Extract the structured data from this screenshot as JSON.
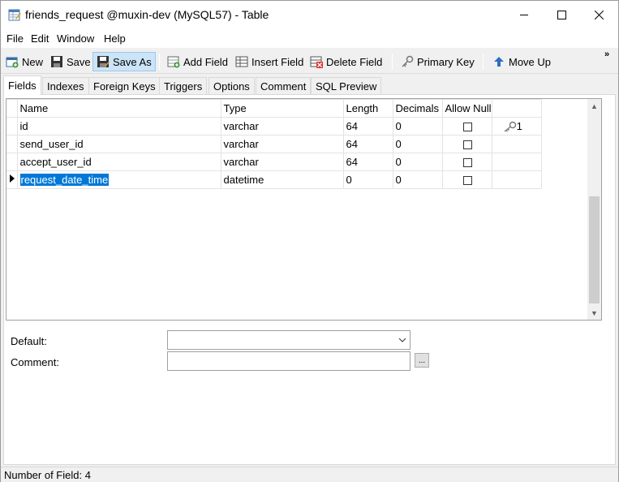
{
  "window": {
    "title": "friends_request @muxin-dev (MySQL57) - Table",
    "controls": {
      "minimize": "—",
      "maximize": "☐",
      "close": "✕"
    }
  },
  "menu": {
    "items": [
      "File",
      "Edit",
      "Window",
      "Help"
    ]
  },
  "toolbar": {
    "new_label": "New",
    "save_label": "Save",
    "save_as_label": "Save As",
    "add_field_label": "Add Field",
    "insert_field_label": "Insert Field",
    "delete_field_label": "Delete Field",
    "primary_key_label": "Primary Key",
    "move_up_label": "Move Up",
    "more_glyph": "»"
  },
  "tabs": [
    "Fields",
    "Indexes",
    "Foreign Keys",
    "Triggers",
    "Options",
    "Comment",
    "SQL Preview"
  ],
  "active_tab": "Fields",
  "grid": {
    "columns": [
      "Name",
      "Type",
      "Length",
      "Decimals",
      "Allow Null"
    ],
    "rows": [
      {
        "name": "id",
        "type": "varchar",
        "length": "64",
        "decimals": "0",
        "allow_null": false,
        "key": "1"
      },
      {
        "name": "send_user_id",
        "type": "varchar",
        "length": "64",
        "decimals": "0",
        "allow_null": false,
        "key": ""
      },
      {
        "name": "accept_user_id",
        "type": "varchar",
        "length": "64",
        "decimals": "0",
        "allow_null": false,
        "key": ""
      },
      {
        "name": "request_date_time",
        "type": "datetime",
        "length": "0",
        "decimals": "0",
        "allow_null": false,
        "key": ""
      }
    ],
    "selected_row": 3
  },
  "properties": {
    "default_label": "Default:",
    "comment_label": "Comment:",
    "default_value": "",
    "comment_value": "",
    "ellipsis": "..."
  },
  "status": {
    "text": "Number of Field: 4"
  },
  "colors": {
    "selection": "#0078d7",
    "active_button": "#cce4f7"
  }
}
